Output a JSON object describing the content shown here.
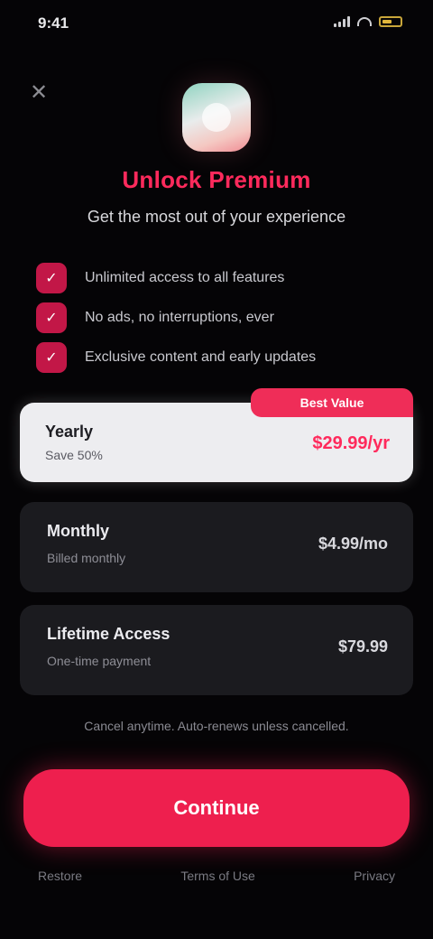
{
  "status": {
    "time": "9:41"
  },
  "close_glyph": "✕",
  "header": {
    "title": "Unlock Premium",
    "subtitle": "Get the most out of your experience"
  },
  "features": [
    {
      "badge": "✓",
      "label": "Unlimited access to all features"
    },
    {
      "badge": "✓",
      "label": "No ads, no interruptions, ever"
    },
    {
      "badge": "✓",
      "label": "Exclusive content and early updates"
    }
  ],
  "plans": {
    "highlight": {
      "ribbon": "Best Value",
      "name": "Yearly",
      "sub": "Save 50%",
      "price": "$29.99/yr"
    },
    "a": {
      "name": "Monthly",
      "sub": "Billed monthly",
      "price": "$4.99/mo"
    },
    "b": {
      "name": "Lifetime Access",
      "sub": "One-time payment",
      "price": "$79.99"
    }
  },
  "fine_print": "Cancel anytime. Auto-renews unless cancelled.",
  "cta": {
    "label": "Continue"
  },
  "footer": {
    "restore": "Restore",
    "terms": "Terms of Use",
    "privacy": "Privacy"
  },
  "colors": {
    "accent": "#ee1f4e",
    "title": "#ff2a5c",
    "background": "#050406",
    "card": "#1b1b1f"
  },
  "icons": {
    "close": "close-icon",
    "feature": "check-icon",
    "battery": "battery-icon",
    "wifi": "wifi-icon",
    "signal": "signal-icon"
  }
}
